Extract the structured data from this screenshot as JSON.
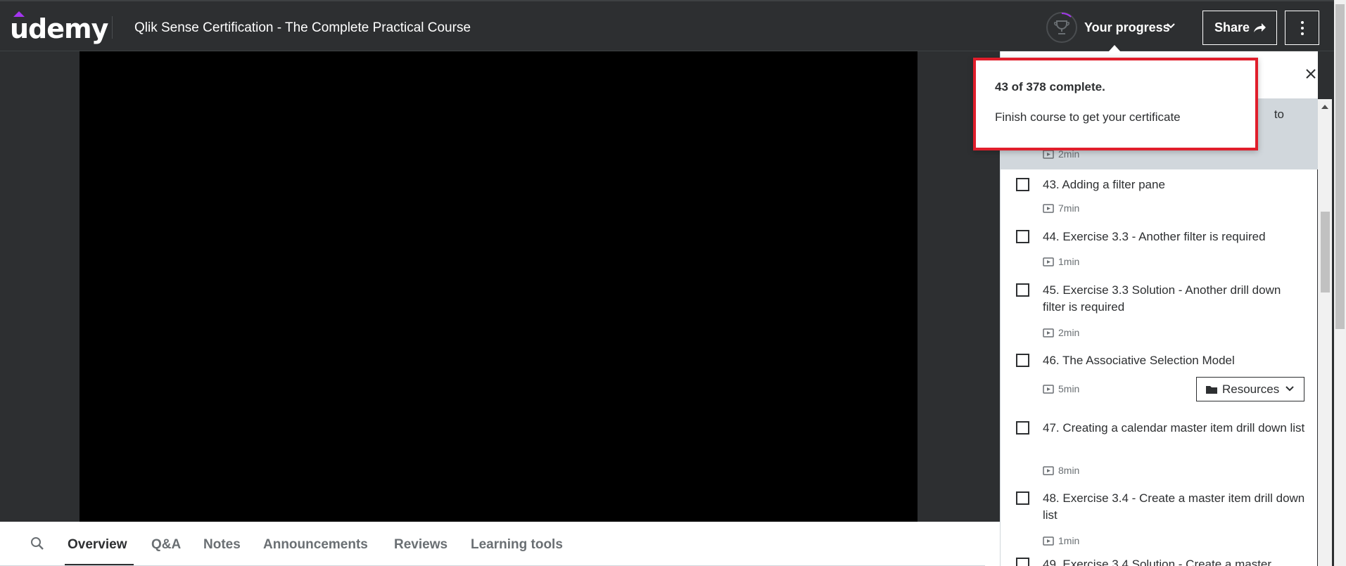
{
  "header": {
    "logo_text": "udemy",
    "course_title": "Qlik Sense Certification - The Complete Practical Course",
    "progress_label": "Your progress",
    "share_label": "Share"
  },
  "progress": {
    "completed": 43,
    "total": 378,
    "fraction": 0.114
  },
  "popover": {
    "count_text": "43 of 378 complete.",
    "message": "Finish course to get your certificate"
  },
  "tabs": [
    {
      "label": "Overview",
      "active": true
    },
    {
      "label": "Q&A",
      "active": false
    },
    {
      "label": "Notes",
      "active": false
    },
    {
      "label": "Announcements",
      "active": false
    },
    {
      "label": "Reviews",
      "active": false
    },
    {
      "label": "Learning tools",
      "active": false
    }
  ],
  "sidebar": {
    "lectures": [
      {
        "title": "to",
        "duration": "2min",
        "current": true
      },
      {
        "title": "43. Adding a filter pane",
        "duration": "7min"
      },
      {
        "title": "44. Exercise 3.3 - Another filter is required",
        "duration": "1min"
      },
      {
        "title": "45. Exercise 3.3 Solution - Another drill down filter is required",
        "duration": "2min"
      },
      {
        "title": "46. The Associative Selection Model",
        "duration": "5min",
        "resources_label": "Resources"
      },
      {
        "title": "47. Creating a calendar master item drill down list",
        "duration": "8min"
      },
      {
        "title": "48. Exercise 3.4 - Create a master item drill down list",
        "duration": "1min"
      },
      {
        "title": "49. Exercise 3.4 Solution - Create a master",
        "duration": ""
      }
    ]
  },
  "colors": {
    "header_bg": "#2d2f31",
    "brand_purple": "#a435f0",
    "highlight_border": "#e01e2b",
    "current_lecture_bg": "#d1d7dc"
  }
}
